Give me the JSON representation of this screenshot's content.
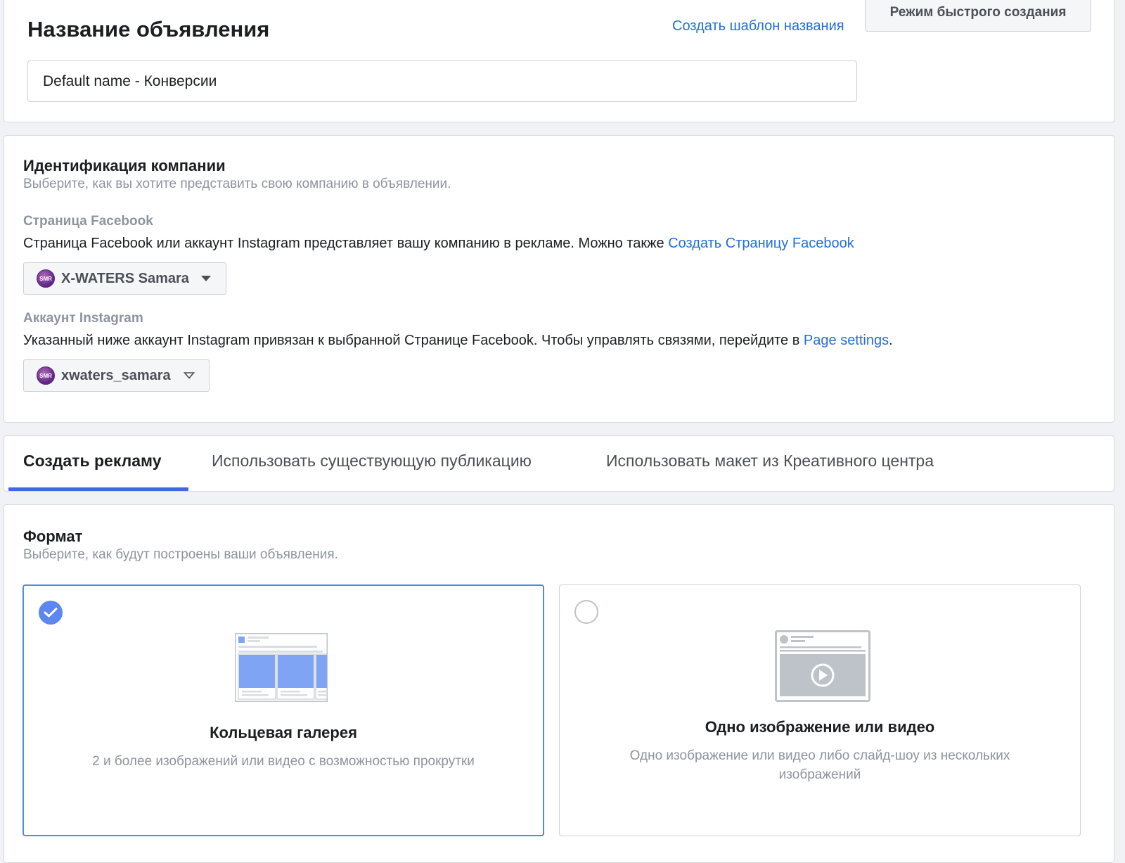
{
  "ad_name": {
    "title": "Название объявления",
    "template_link": "Создать шаблон названия",
    "quick_mode_button": "Режим быстрого создания",
    "input_value": "Default name - Конверсии"
  },
  "identity": {
    "title": "Идентификация компании",
    "subtitle": "Выберите, как вы хотите представить свою компанию в объявлении.",
    "facebook_page": {
      "label": "Страница Facebook",
      "description": "Страница Facebook или аккаунт Instagram представляет вашу компанию в рекламе. Можно также ",
      "link": "Создать Страницу Facebook",
      "selected": "X-WATERS Samara",
      "avatar_text": "SMR"
    },
    "instagram": {
      "label": "Аккаунт Instagram",
      "description": "Указанный ниже аккаунт Instagram привязан к выбранной Странице Facebook. Чтобы управлять связями, перейдите в ",
      "link": "Page settings",
      "suffix": ".",
      "selected": "xwaters_samara",
      "avatar_text": "SMR"
    }
  },
  "tabs": [
    {
      "label": "Создать рекламу",
      "active": true
    },
    {
      "label": "Использовать существующую публикацию",
      "active": false
    },
    {
      "label": "Использовать макет из Креативного центра",
      "active": false
    }
  ],
  "format": {
    "title": "Формат",
    "subtitle": "Выберите, как будут построены ваши объявления.",
    "options": [
      {
        "title": "Кольцевая галерея",
        "description": "2 и более изображений или видео с возможностью прокрутки",
        "selected": true,
        "icon": "carousel-icon"
      },
      {
        "title": "Одно изображение или видео",
        "description": "Одно изображение или видео либо слайд-шоу из нескольких изображений",
        "selected": false,
        "icon": "single-media-icon"
      }
    ]
  },
  "colors": {
    "link": "#216fdb",
    "tab_indicator": "#4267e4",
    "selected_border": "#4c8be6",
    "carousel_fill": "#7fa4f3"
  }
}
